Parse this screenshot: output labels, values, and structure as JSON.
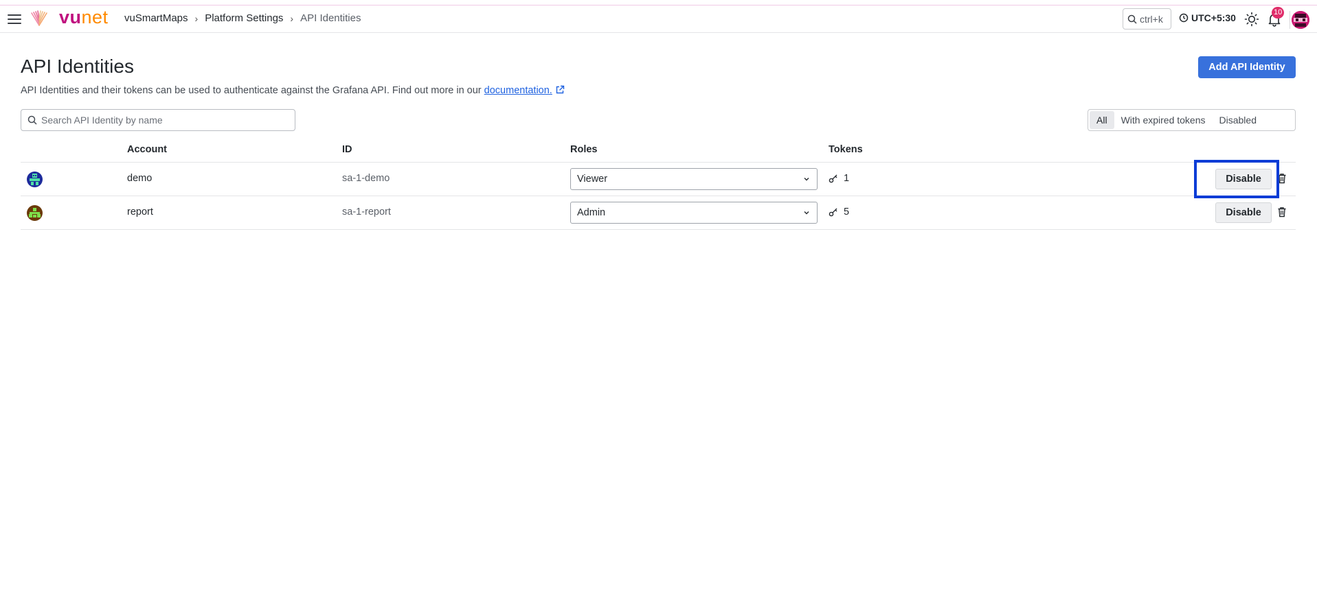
{
  "topbar": {
    "brand_left": "vu",
    "brand_right": "net",
    "breadcrumb": [
      "vuSmartMaps",
      "Platform Settings",
      "API Identities"
    ],
    "search_shortcut": "ctrl+k",
    "timezone": "UTC+5:30",
    "notification_count": "10",
    "icons": [
      "menu-icon",
      "vunet-logo-icon",
      "search-icon",
      "clock-icon",
      "sun-icon",
      "bell-icon",
      "user-avatar"
    ]
  },
  "page": {
    "title": "API Identities",
    "description": "API Identities and their tokens can be used to authenticate against the Grafana API. Find out more in our ",
    "doc_link": "documentation.",
    "add_button": "Add API Identity",
    "search_placeholder": "Search API Identity by name",
    "filters": [
      "All",
      "With expired tokens",
      "Disabled"
    ],
    "active_filter": "All"
  },
  "table": {
    "headers": {
      "account": "Account",
      "id": "ID",
      "roles": "Roles",
      "tokens": "Tokens"
    },
    "rows": [
      {
        "account": "demo",
        "id": "sa-1-demo",
        "role": "Viewer",
        "tokens": "1",
        "action": "Disable"
      },
      {
        "account": "report",
        "id": "sa-1-report",
        "role": "Admin",
        "tokens": "5",
        "action": "Disable"
      }
    ]
  },
  "colors": {
    "accent": "#3871dc",
    "brand_pink": "#c0117f",
    "brand_orange": "#ff8a00",
    "highlight_box": "#0a3cd6"
  }
}
